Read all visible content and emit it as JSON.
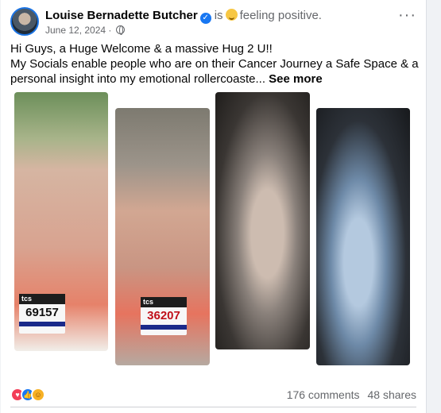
{
  "post": {
    "author": "Louise Bernadette Butcher",
    "verb": "is",
    "feeling": "feeling positive.",
    "date": "June 12, 2024",
    "more_label": "···",
    "text_line1": "Hi Guys, a Huge Welcome & a massive Hug 2 U!!",
    "text_line2": "My Socials enable people who are on their Cancer Journey a Safe Space & a personal insight into my emotional rollercoaste...",
    "see_more": "See more"
  },
  "photos": {
    "bib1": {
      "brand": "tcs",
      "number": "69157"
    },
    "bib2": {
      "brand": "tcs",
      "number": "36207"
    }
  },
  "stats": {
    "comments": "176 comments",
    "shares": "48 shares"
  },
  "icons": {
    "verified": "verified-badge-icon",
    "feeling": "relieved-face-emoji-icon",
    "audience": "globe-icon",
    "reactions": [
      "love-reaction-icon",
      "like-reaction-icon",
      "care-reaction-icon"
    ]
  },
  "colors": {
    "brand": "#1877f2",
    "love": "#f33e58",
    "care": "#f7b125",
    "secondary_text": "#65676b"
  }
}
